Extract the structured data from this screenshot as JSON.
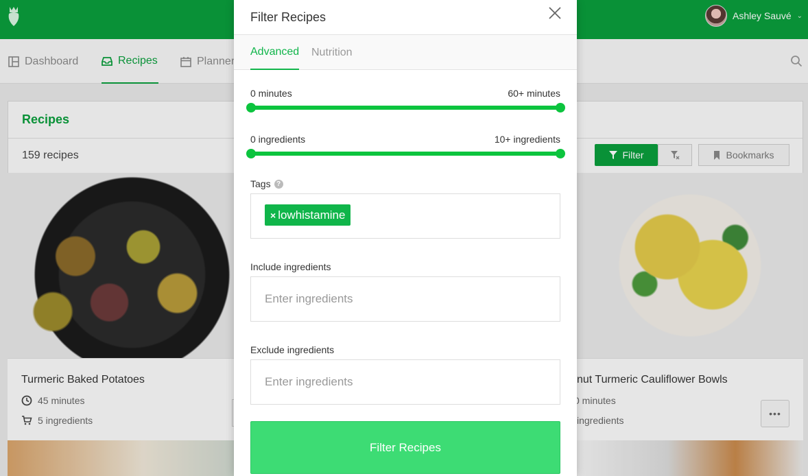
{
  "user": {
    "name": "Ashley Sauvé"
  },
  "nav": {
    "items": [
      {
        "label": "Dashboard",
        "icon": "dashboard-icon"
      },
      {
        "label": "Recipes",
        "icon": "tray-icon",
        "active": true
      },
      {
        "label": "Planner",
        "icon": "calendar-icon"
      }
    ]
  },
  "panel": {
    "title": "Recipes",
    "count": "159 recipes",
    "filter_label": "Filter",
    "bookmarks_label": "Bookmarks"
  },
  "cards": [
    {
      "title": "Turmeric Baked Potatoes",
      "time": "45 minutes",
      "ingredients": "5 ingredients"
    },
    {
      "title": "nut Turmeric Cauliflower Bowls",
      "time": "0 minutes",
      "ingredients": "ingredients"
    }
  ],
  "modal": {
    "title": "Filter Recipes",
    "tabs": [
      {
        "label": "Advanced",
        "active": true
      },
      {
        "label": "Nutrition"
      }
    ],
    "time_range": {
      "min_label": "0 minutes",
      "max_label": "60+ minutes",
      "low": 0,
      "high": 1
    },
    "ingredient_range": {
      "min_label": "0 ingredients",
      "max_label": "10+ ingredients",
      "low": 0,
      "high": 1
    },
    "tags_label": "Tags",
    "tags": [
      "lowhistamine"
    ],
    "include_label": "Include ingredients",
    "include_placeholder": "Enter ingredients",
    "exclude_label": "Exclude ingredients",
    "exclude_placeholder": "Enter ingredients",
    "submit_label": "Filter Recipes"
  },
  "colors": {
    "brand": "#0a9e3c",
    "accent": "#0cc43e",
    "button": "#3ddc74"
  }
}
